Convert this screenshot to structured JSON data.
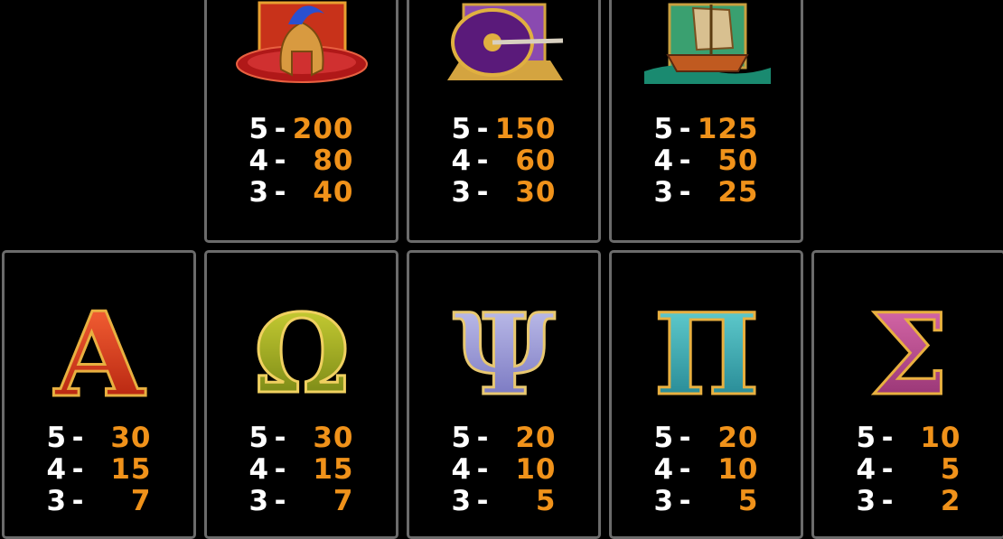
{
  "colors": {
    "accent": "#f0921a",
    "text": "#ffffff",
    "border": "#6b6b6b"
  },
  "top_row": [
    {
      "symbol": "spartan-helmet",
      "pays": [
        {
          "count": "5",
          "value": "200"
        },
        {
          "count": "4",
          "value": "80"
        },
        {
          "count": "3",
          "value": "40"
        }
      ]
    },
    {
      "symbol": "shield-and-sword",
      "pays": [
        {
          "count": "5",
          "value": "150"
        },
        {
          "count": "4",
          "value": "60"
        },
        {
          "count": "3",
          "value": "30"
        }
      ]
    },
    {
      "symbol": "trireme-ship",
      "pays": [
        {
          "count": "5",
          "value": "125"
        },
        {
          "count": "4",
          "value": "50"
        },
        {
          "count": "3",
          "value": "25"
        }
      ]
    }
  ],
  "bottom_row": [
    {
      "symbol": "Α",
      "symbol_name": "alpha",
      "pays": [
        {
          "count": "5",
          "value": "30"
        },
        {
          "count": "4",
          "value": "15"
        },
        {
          "count": "3",
          "value": "7"
        }
      ]
    },
    {
      "symbol": "Ω",
      "symbol_name": "omega",
      "pays": [
        {
          "count": "5",
          "value": "30"
        },
        {
          "count": "4",
          "value": "15"
        },
        {
          "count": "3",
          "value": "7"
        }
      ]
    },
    {
      "symbol": "Ψ",
      "symbol_name": "psi",
      "pays": [
        {
          "count": "5",
          "value": "20"
        },
        {
          "count": "4",
          "value": "10"
        },
        {
          "count": "3",
          "value": "5"
        }
      ]
    },
    {
      "symbol": "Π",
      "symbol_name": "pi",
      "pays": [
        {
          "count": "5",
          "value": "20"
        },
        {
          "count": "4",
          "value": "10"
        },
        {
          "count": "3",
          "value": "5"
        }
      ]
    },
    {
      "symbol": "Σ",
      "symbol_name": "sigma",
      "pays": [
        {
          "count": "5",
          "value": "10"
        },
        {
          "count": "4",
          "value": "5"
        },
        {
          "count": "3",
          "value": "2"
        }
      ]
    }
  ],
  "dash": "-"
}
